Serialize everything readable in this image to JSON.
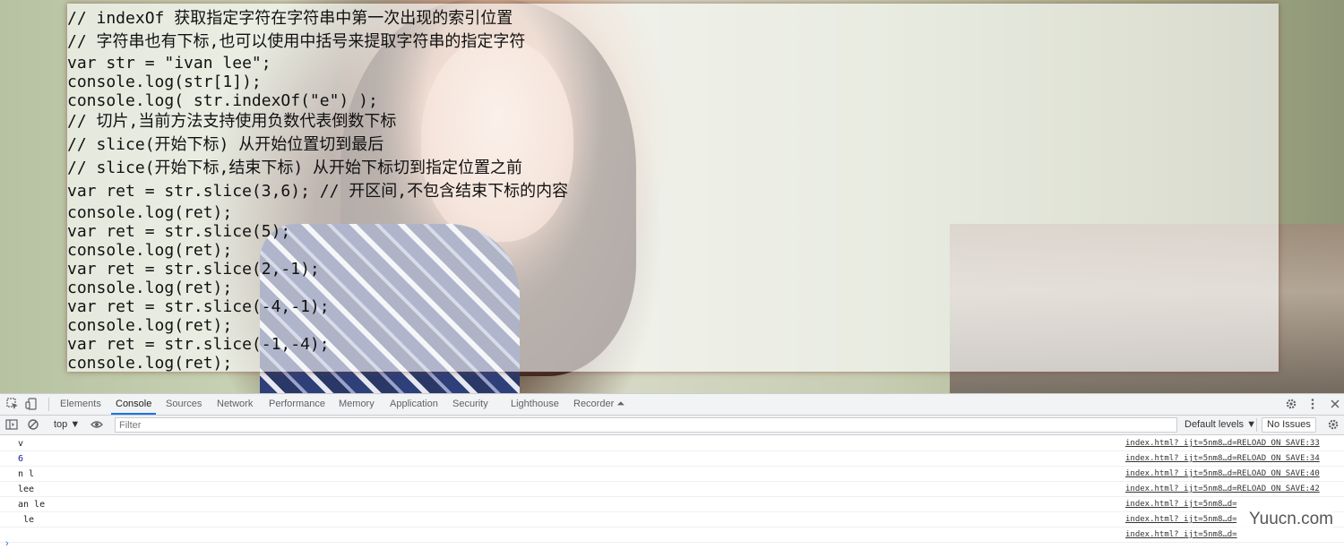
{
  "code_lines": [
    "// indexOf 获取指定字符在字符串中第一次出现的索引位置",
    "// 字符串也有下标,也可以使用中括号来提取字符串的指定字符",
    "var str = \"ivan lee\";",
    "console.log(str[1]);",
    "console.log( str.indexOf(\"e\") );",
    "// 切片,当前方法支持使用负数代表倒数下标",
    "// slice(开始下标) 从开始位置切到最后",
    "// slice(开始下标,结束下标) 从开始下标切到指定位置之前",
    "var ret = str.slice(3,6); // 开区间,不包含结束下标的内容",
    "console.log(ret);",
    "var ret = str.slice(5);",
    "console.log(ret);",
    "var ret = str.slice(2,-1);",
    "console.log(ret);",
    "var ret = str.slice(-4,-1);",
    "console.log(ret);",
    "var ret = str.slice(-1,-4);",
    "console.log(ret);"
  ],
  "devtools": {
    "tabs": [
      "Elements",
      "Console",
      "Sources",
      "Network",
      "Performance",
      "Memory",
      "Application",
      "Security",
      "Lighthouse",
      "Recorder ⏶"
    ],
    "active_tab": "Console",
    "context": "top ▼",
    "filter_placeholder": "Filter",
    "levels": "Default levels ▼",
    "issues": "No Issues"
  },
  "console_rows": [
    {
      "msg": "v",
      "src": "index.html?_ijt=5nm8…d=RELOAD_ON_SAVE:33",
      "type": "string"
    },
    {
      "msg": "6",
      "src": "index.html?_ijt=5nm8…d=RELOAD_ON_SAVE:34",
      "type": "number"
    },
    {
      "msg": "n l",
      "src": "index.html?_ijt=5nm8…d=RELOAD_ON_SAVE:40",
      "type": "string"
    },
    {
      "msg": "lee",
      "src": "index.html?_ijt=5nm8…d=RELOAD_ON_SAVE:42",
      "type": "string"
    },
    {
      "msg": "an le",
      "src": "index.html?_ijt=5nm8…d=",
      "type": "string"
    },
    {
      "msg": " le",
      "src": "index.html?_ijt=5nm8…d=",
      "type": "string"
    },
    {
      "msg": "",
      "src": "index.html?_ijt=5nm8…d=",
      "type": "string"
    }
  ],
  "prompt": "›",
  "watermark": "Yuucn.com",
  "icons": {
    "inspect": "inspect-icon",
    "device": "device-toggle-icon",
    "gear": "gear-icon",
    "more": "more-vertical-icon",
    "close": "close-icon",
    "sidebar": "sidebar-toggle-icon",
    "clear": "clear-console-icon",
    "eye": "eye-icon"
  },
  "colors": {
    "accent": "#1a73e8",
    "number": "#1a1aa6"
  }
}
